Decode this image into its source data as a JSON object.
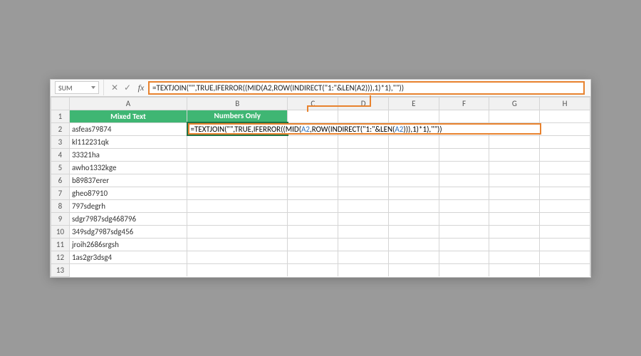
{
  "nameBox": "SUM",
  "formulaBar": "=TEXTJOIN(\"\",TRUE,IFERROR((MID(A2,ROW(INDIRECT(\"1:\"&LEN(A2))),1)*1),\"\"))",
  "columns": [
    "A",
    "B",
    "C",
    "D",
    "E",
    "F",
    "G",
    "H"
  ],
  "headers": {
    "A": "Mixed Text",
    "B": "Numbers Only"
  },
  "activeCellFormula": {
    "p1": "=TEXTJOIN(\"\",TRUE,IFERROR((MID(",
    "r1": "A2",
    "p2": ",ROW(INDIRECT(\"1:\"&LEN(",
    "r2": "A2",
    "p3": "))),1)*1),\"\"))"
  },
  "rows": [
    {
      "n": 2,
      "A": "asfeas79874"
    },
    {
      "n": 3,
      "A": "kl112231qk"
    },
    {
      "n": 4,
      "A": "33321ha"
    },
    {
      "n": 5,
      "A": "awho1332kge"
    },
    {
      "n": 6,
      "A": "b89837erer"
    },
    {
      "n": 7,
      "A": "gheo87910"
    },
    {
      "n": 8,
      "A": "797sdegrh"
    },
    {
      "n": 9,
      "A": "sdgr7987sdg468796"
    },
    {
      "n": 10,
      "A": "349sdg7987sdg456"
    },
    {
      "n": 11,
      "A": "jroih2686srgsh"
    },
    {
      "n": 12,
      "A": "1as2gr3dsg4"
    },
    {
      "n": 13,
      "A": ""
    }
  ]
}
